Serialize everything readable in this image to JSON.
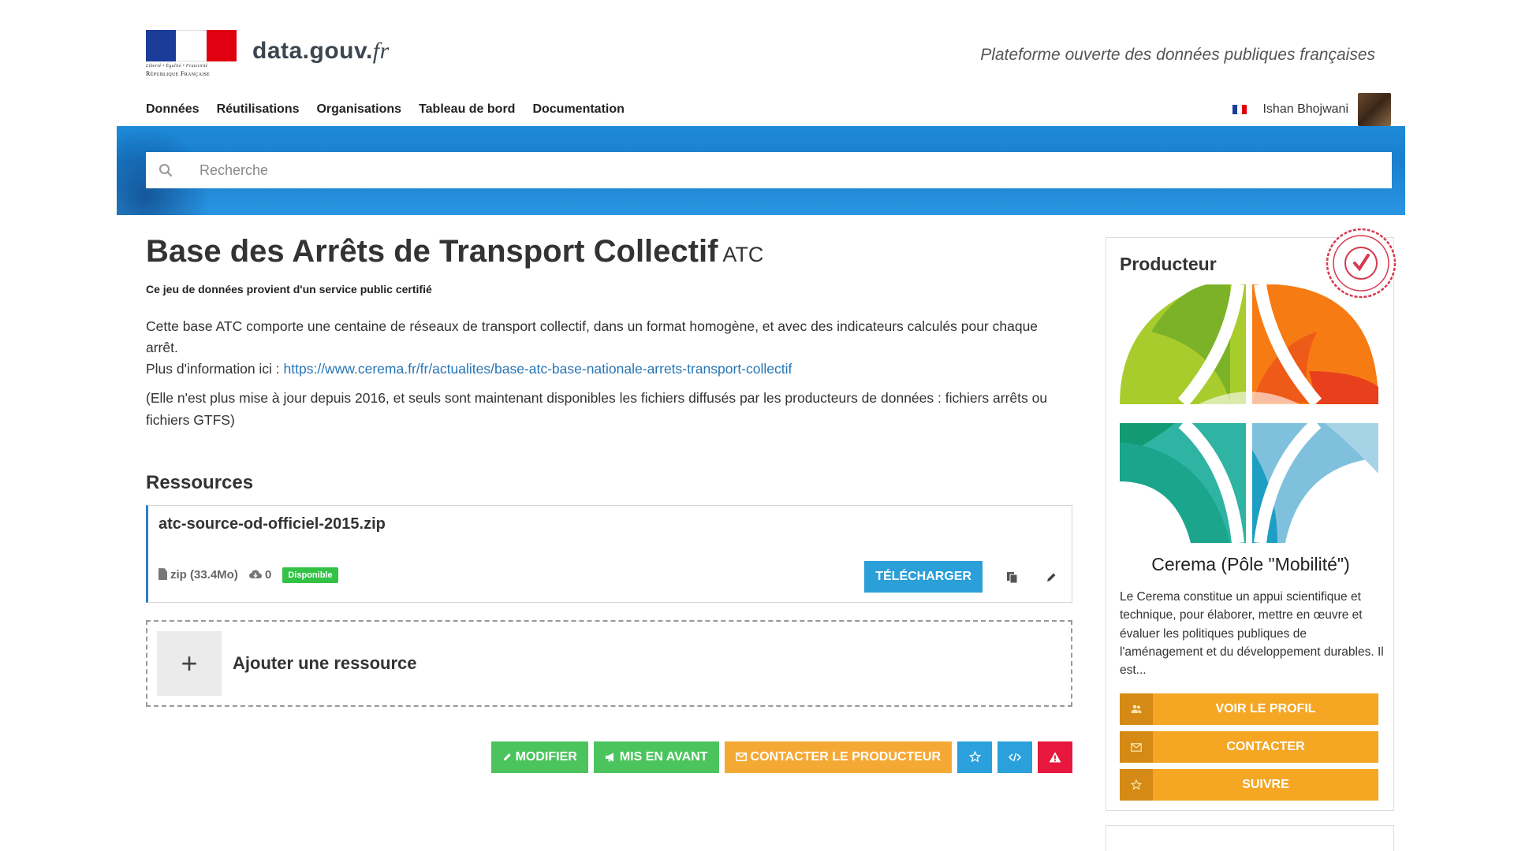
{
  "header": {
    "brand_name": "data.gouv.",
    "brand_suffix": "fr",
    "logo_motto": "Liberté • Égalité • Fraternité",
    "logo_name": "République Française",
    "tagline": "Plateforme ouverte des données publiques françaises"
  },
  "nav": {
    "items": [
      "Données",
      "Réutilisations",
      "Organisations",
      "Tableau de bord",
      "Documentation"
    ],
    "user_name": "Ishan Bhojwani"
  },
  "search": {
    "placeholder": "Recherche",
    "icon": "search-icon"
  },
  "dataset": {
    "title": "Base des Arrêts de Transport Collectif",
    "acronym": "ATC",
    "certified_note": "Ce jeu de données provient d'un service public certifié",
    "desc_line1": "Cette base ATC comporte une centaine de réseaux de transport collectif, dans un format homogène, et avec des indicateurs calculés pour chaque arrêt.",
    "desc_line2_prefix": "Plus d'information ici : ",
    "desc_link": "https://www.cerema.fr/fr/actualites/base-atc-base-nationale-arrets-transport-collectif",
    "desc_line3": "(Elle n'est plus mise à jour depuis 2016, et seuls sont maintenant disponibles les fichiers diffusés par les producteurs de données : fichiers arrêts ou fichiers GTFS)"
  },
  "resources": {
    "section_title": "Ressources",
    "items": [
      {
        "name": "atc-source-od-officiel-2015.zip",
        "format_size": "zip (33.4Mo)",
        "downloads": "0",
        "status": "Disponible",
        "download_label": "TÉLÉCHARGER"
      }
    ],
    "add_label": "Ajouter une ressource",
    "add_symbol": "+"
  },
  "actions": {
    "modify": "MODIFIER",
    "feature": "MIS EN AVANT",
    "contact_producer": "CONTACTER LE PRODUCTEUR"
  },
  "producer": {
    "section_title": "Producteur",
    "org_name": "Cerema (Pôle \"Mobilité\")",
    "description": "Le Cerema constitue un appui scientifique et technique, pour élaborer, mettre en œuvre et évaluer les politiques publiques de l'aménagement et du développement durables. Il est...",
    "seal_text": "PRODUCTEUR CERTIFIÉ",
    "buttons": [
      {
        "label": "VOIR LE PROFIL",
        "icon": "users-icon"
      },
      {
        "label": "CONTACTER",
        "icon": "envelope-icon"
      },
      {
        "label": "SUIVRE",
        "icon": "star-icon"
      }
    ]
  },
  "colors": {
    "search_band": "#1d8ad8",
    "link": "#2775b6",
    "download": "#2a9fd8",
    "green": "#4cc45e",
    "orange": "#f5a935",
    "red": "#e8173d",
    "badge": "#33c245"
  }
}
